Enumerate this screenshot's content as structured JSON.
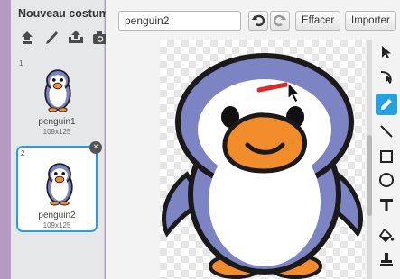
{
  "panel": {
    "title": "Nouveau costume:",
    "new_tools": [
      {
        "icon": "stamp-icon"
      },
      {
        "icon": "paintbrush-icon"
      },
      {
        "icon": "upload-icon"
      },
      {
        "icon": "camera-icon"
      }
    ]
  },
  "costumes": [
    {
      "number": "1",
      "name": "penguin1",
      "size": "109x125",
      "selected": false
    },
    {
      "number": "2",
      "name": "penguin2",
      "size": "109x125",
      "selected": true
    }
  ],
  "editor": {
    "costume_name": "penguin2",
    "clear_label": "Effacer",
    "import_label": "Importer"
  },
  "tools": [
    {
      "icon": "select-arrow-icon",
      "active": false
    },
    {
      "icon": "reshape-icon",
      "active": false
    },
    {
      "icon": "pencil-icon",
      "active": true
    },
    {
      "icon": "line-icon",
      "active": false
    },
    {
      "icon": "rectangle-icon",
      "active": false
    },
    {
      "icon": "ellipse-icon",
      "active": false
    },
    {
      "icon": "text-icon",
      "active": false
    },
    {
      "icon": "fill-icon",
      "active": false
    },
    {
      "icon": "stamp-tool-icon",
      "active": false
    }
  ],
  "colors": {
    "selection": "#1fa2e3",
    "penguin_body": "#7d84c4",
    "beak": "#f28b2a",
    "brush_stroke": "#e02828"
  }
}
